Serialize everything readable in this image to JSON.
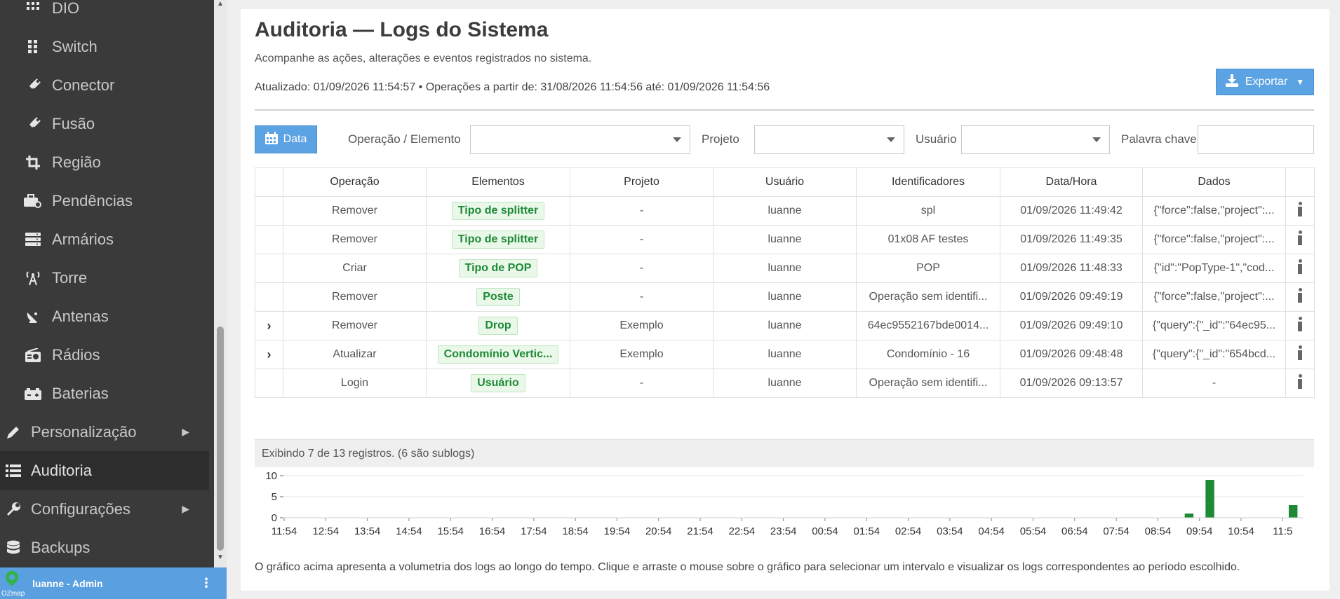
{
  "sidebar": {
    "items": [
      {
        "label": "DIO",
        "icon": "grid-icon"
      },
      {
        "label": "Switch",
        "icon": "switch-icon"
      },
      {
        "label": "Conector",
        "icon": "plug-icon"
      },
      {
        "label": "Fusão",
        "icon": "plug-icon"
      },
      {
        "label": "Região",
        "icon": "crop-icon"
      },
      {
        "label": "Pendências",
        "icon": "toolbox-icon"
      },
      {
        "label": "Armários",
        "icon": "server-icon"
      },
      {
        "label": "Torre",
        "icon": "tower-icon"
      },
      {
        "label": "Antenas",
        "icon": "satellite-dish-icon"
      },
      {
        "label": "Rádios",
        "icon": "radio-icon"
      },
      {
        "label": "Baterias",
        "icon": "battery-icon"
      }
    ],
    "top_items": [
      {
        "label": "Personalização",
        "icon": "pencil-icon",
        "has_submenu": true
      },
      {
        "label": "Auditoria",
        "icon": "list-icon",
        "active": true
      },
      {
        "label": "Configurações",
        "icon": "wrench-icon",
        "has_submenu": true
      },
      {
        "label": "Backups",
        "icon": "database-icon"
      }
    ],
    "user": {
      "name": "luanne - Admin",
      "brand": "OZmap"
    }
  },
  "header": {
    "title": "Auditoria — Logs do Sistema",
    "subtitle": "Acompanhe as ações, alterações e eventos registrados no sistema.",
    "updated": "Atualizado: 01/09/2026 11:54:57 • Operações a partir de: 31/08/2026 11:54:56 até: 01/09/2026 11:54:56",
    "export_label": "Exportar"
  },
  "filters": {
    "date_label": "Data",
    "operation_label": "Operação / Elemento",
    "project_label": "Projeto",
    "user_label": "Usuário",
    "keyword_label": "Palavra chave"
  },
  "table": {
    "columns": [
      "Operação",
      "Elementos",
      "Projeto",
      "Usuário",
      "Identificadores",
      "Data/Hora",
      "Dados"
    ],
    "rows": [
      {
        "expand": "",
        "operacao": "Remover",
        "elemento": "Tipo de splitter",
        "projeto": "-",
        "usuario": "luanne",
        "identificador": "spl",
        "datahora": "01/09/2026 11:49:42",
        "dados": "{\"force\":false,\"project\":..."
      },
      {
        "expand": "",
        "operacao": "Remover",
        "elemento": "Tipo de splitter",
        "projeto": "-",
        "usuario": "luanne",
        "identificador": "01x08 AF testes",
        "datahora": "01/09/2026 11:49:35",
        "dados": "{\"force\":false,\"project\":..."
      },
      {
        "expand": "",
        "operacao": "Criar",
        "elemento": "Tipo de POP",
        "projeto": "-",
        "usuario": "luanne",
        "identificador": "POP",
        "datahora": "01/09/2026 11:48:33",
        "dados": "{\"id\":\"PopType-1\",\"cod..."
      },
      {
        "expand": "",
        "operacao": "Remover",
        "elemento": "Poste",
        "projeto": "-",
        "usuario": "luanne",
        "identificador": "Operação sem identifi...",
        "datahora": "01/09/2026 09:49:19",
        "dados": "{\"force\":false,\"project\":..."
      },
      {
        "expand": "›",
        "operacao": "Remover",
        "elemento": "Drop",
        "projeto": "Exemplo",
        "usuario": "luanne",
        "identificador": "64ec9552167bde0014...",
        "datahora": "01/09/2026 09:49:10",
        "dados": "{\"query\":{\"_id\":\"64ec95..."
      },
      {
        "expand": "›",
        "operacao": "Atualizar",
        "elemento": "Condomínio Vertic...",
        "projeto": "Exemplo",
        "usuario": "luanne",
        "identificador": "Condomínio - 16",
        "datahora": "01/09/2026 09:48:48",
        "dados": "{\"query\":{\"_id\":\"654bcd..."
      },
      {
        "expand": "",
        "operacao": "Login",
        "elemento": "Usuário",
        "projeto": "-",
        "usuario": "luanne",
        "identificador": "Operação sem identifi...",
        "datahora": "01/09/2026 09:13:57",
        "dados": "-"
      }
    ]
  },
  "footer": {
    "count_text": "Exibindo 7 de 13 registros. (6 são sublogs)",
    "note": "O gráfico acima apresenta a volumetria dos logs ao longo do tempo. Clique e arraste o mouse sobre o gráfico para selecionar um intervalo e visualizar os logs correspondentes ao período escolhido."
  },
  "chart_data": {
    "type": "bar",
    "categories": [
      "11:54",
      "12:54",
      "13:54",
      "14:54",
      "15:54",
      "16:54",
      "17:54",
      "18:54",
      "19:54",
      "20:54",
      "21:54",
      "22:54",
      "23:54",
      "00:54",
      "01:54",
      "02:54",
      "03:54",
      "04:54",
      "05:54",
      "06:54",
      "07:54",
      "08:54",
      "09:54",
      "10:54",
      "11:5"
    ],
    "bins_per_category": 2,
    "values": [
      0,
      0,
      0,
      0,
      0,
      0,
      0,
      0,
      0,
      0,
      0,
      0,
      0,
      0,
      0,
      0,
      0,
      0,
      0,
      0,
      0,
      0,
      0,
      0,
      0,
      0,
      0,
      0,
      0,
      0,
      0,
      0,
      0,
      0,
      0,
      0,
      0,
      0,
      0,
      0,
      0,
      0,
      0,
      1,
      9,
      0,
      0,
      0,
      3,
      0
    ],
    "yticks": [
      0,
      5,
      10
    ],
    "ylim": [
      0,
      10
    ],
    "color": "#1e8a36",
    "grid": true,
    "title": "",
    "xlabel": "",
    "ylabel": ""
  }
}
